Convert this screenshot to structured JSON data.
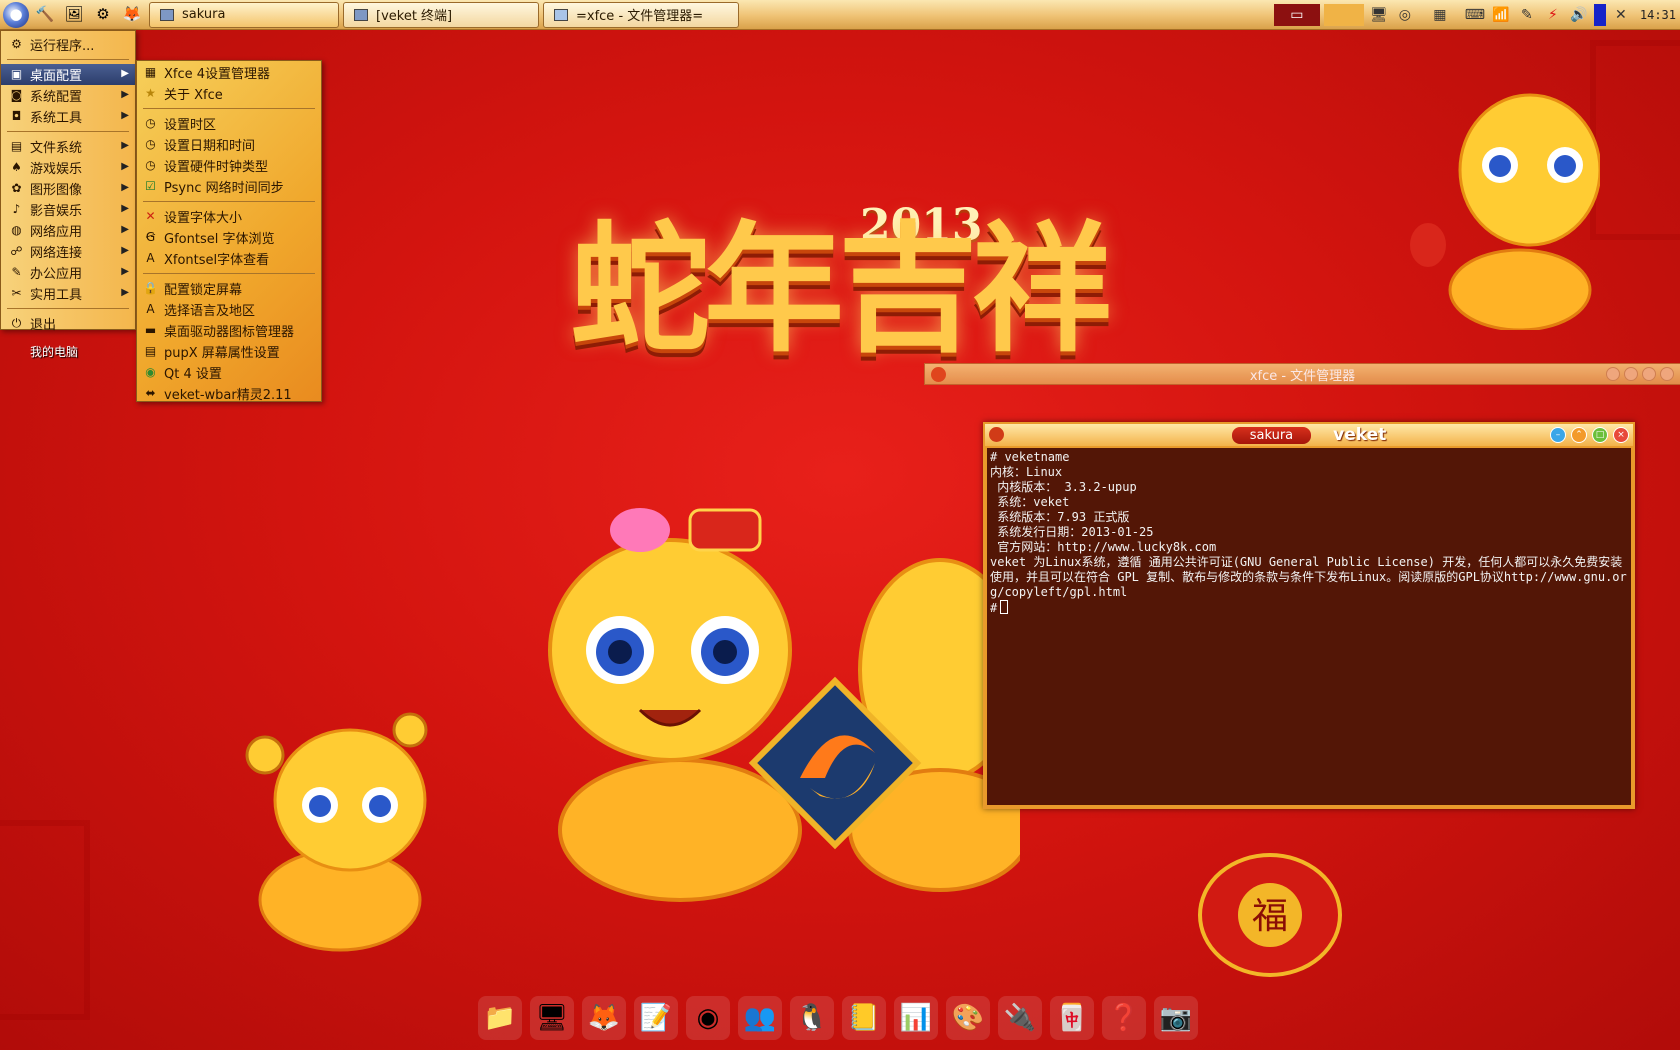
{
  "taskbar": {
    "tasks": [
      {
        "label": "sakura"
      },
      {
        "label": "[veket 终端]"
      },
      {
        "label": "=xfce - 文件管理器="
      }
    ],
    "clock": "14:31"
  },
  "main_menu": {
    "items": [
      {
        "label": "运行程序...",
        "icon": "run-icon"
      },
      {
        "label": "桌面配置",
        "icon": "desktop-config-icon",
        "submenu": true
      },
      {
        "label": "系统配置",
        "icon": "system-config-icon",
        "submenu": true
      },
      {
        "label": "系统工具",
        "icon": "system-tools-icon",
        "submenu": true
      },
      {
        "label": "文件系统",
        "icon": "filesystem-icon",
        "submenu": true
      },
      {
        "label": "游戏娱乐",
        "icon": "games-icon",
        "submenu": true
      },
      {
        "label": "图形图像",
        "icon": "graphics-icon",
        "submenu": true
      },
      {
        "label": "影音娱乐",
        "icon": "multimedia-icon",
        "submenu": true
      },
      {
        "label": "网络应用",
        "icon": "internet-icon",
        "submenu": true
      },
      {
        "label": "网络连接",
        "icon": "network-icon",
        "submenu": true
      },
      {
        "label": "办公应用",
        "icon": "office-icon",
        "submenu": true
      },
      {
        "label": "实用工具",
        "icon": "utilities-icon",
        "submenu": true
      },
      {
        "label": "退出",
        "icon": "exit-icon"
      }
    ]
  },
  "sub_menu": {
    "items": [
      {
        "label": "Xfce 4设置管理器",
        "icon": "settings-manager-icon"
      },
      {
        "label": "关于 Xfce",
        "icon": "star-icon"
      },
      {
        "label": "设置时区",
        "icon": "clock-icon"
      },
      {
        "label": "设置日期和时间",
        "icon": "clock-icon"
      },
      {
        "label": "设置硬件时钟类型",
        "icon": "clock-icon"
      },
      {
        "label": "Psync 网络时间同步",
        "icon": "sync-icon"
      },
      {
        "label": "设置字体大小",
        "icon": "font-size-icon"
      },
      {
        "label": "Gfontsel 字体浏览",
        "icon": "font-browser-icon"
      },
      {
        "label": "Xfontsel字体查看",
        "icon": "font-viewer-icon"
      },
      {
        "label": "配置锁定屏幕",
        "icon": "lock-icon"
      },
      {
        "label": "选择语言及地区",
        "icon": "language-icon"
      },
      {
        "label": "桌面驱动器图标管理器",
        "icon": "drive-icon"
      },
      {
        "label": "pupX 屏幕属性设置",
        "icon": "screen-icon"
      },
      {
        "label": "Qt 4 设置",
        "icon": "qt-icon"
      },
      {
        "label": "veket-wbar精灵2.11",
        "icon": "wbar-icon"
      }
    ]
  },
  "desktop": {
    "icon_label": "我的电脑",
    "wallpaper_title": "蛇年吉祥",
    "wallpaper_year": "2013"
  },
  "file_manager": {
    "title": "xfce - 文件管理器"
  },
  "terminal": {
    "title": "sakura",
    "brand": "veket",
    "lines": [
      "# veketname",
      "内核：Linux",
      " 内核版本： 3.3.2-upup",
      " 系统：veket",
      " 系统版本：7.93 正式版",
      " 系统发行日期：2013-01-25",
      " 官方网站：http://www.lucky8k.com",
      "veket 为Linux系统，遵循 通用公共许可证(GNU General Public License) 开发，任何人都可以永久免费安装使用，并且可以在符合 GPL 复制、散布与修改的条款与条件下发布Linux。阅读原版的GPL协议http://www.gnu.org/copyleft/gpl.html"
    ],
    "prompt": "#"
  },
  "colors": {
    "desktop_bg": "#d3140f",
    "panel_bg": "#efc274",
    "menu_highlight": "#2c3d6b",
    "terminal_bg": "#3a0000"
  }
}
